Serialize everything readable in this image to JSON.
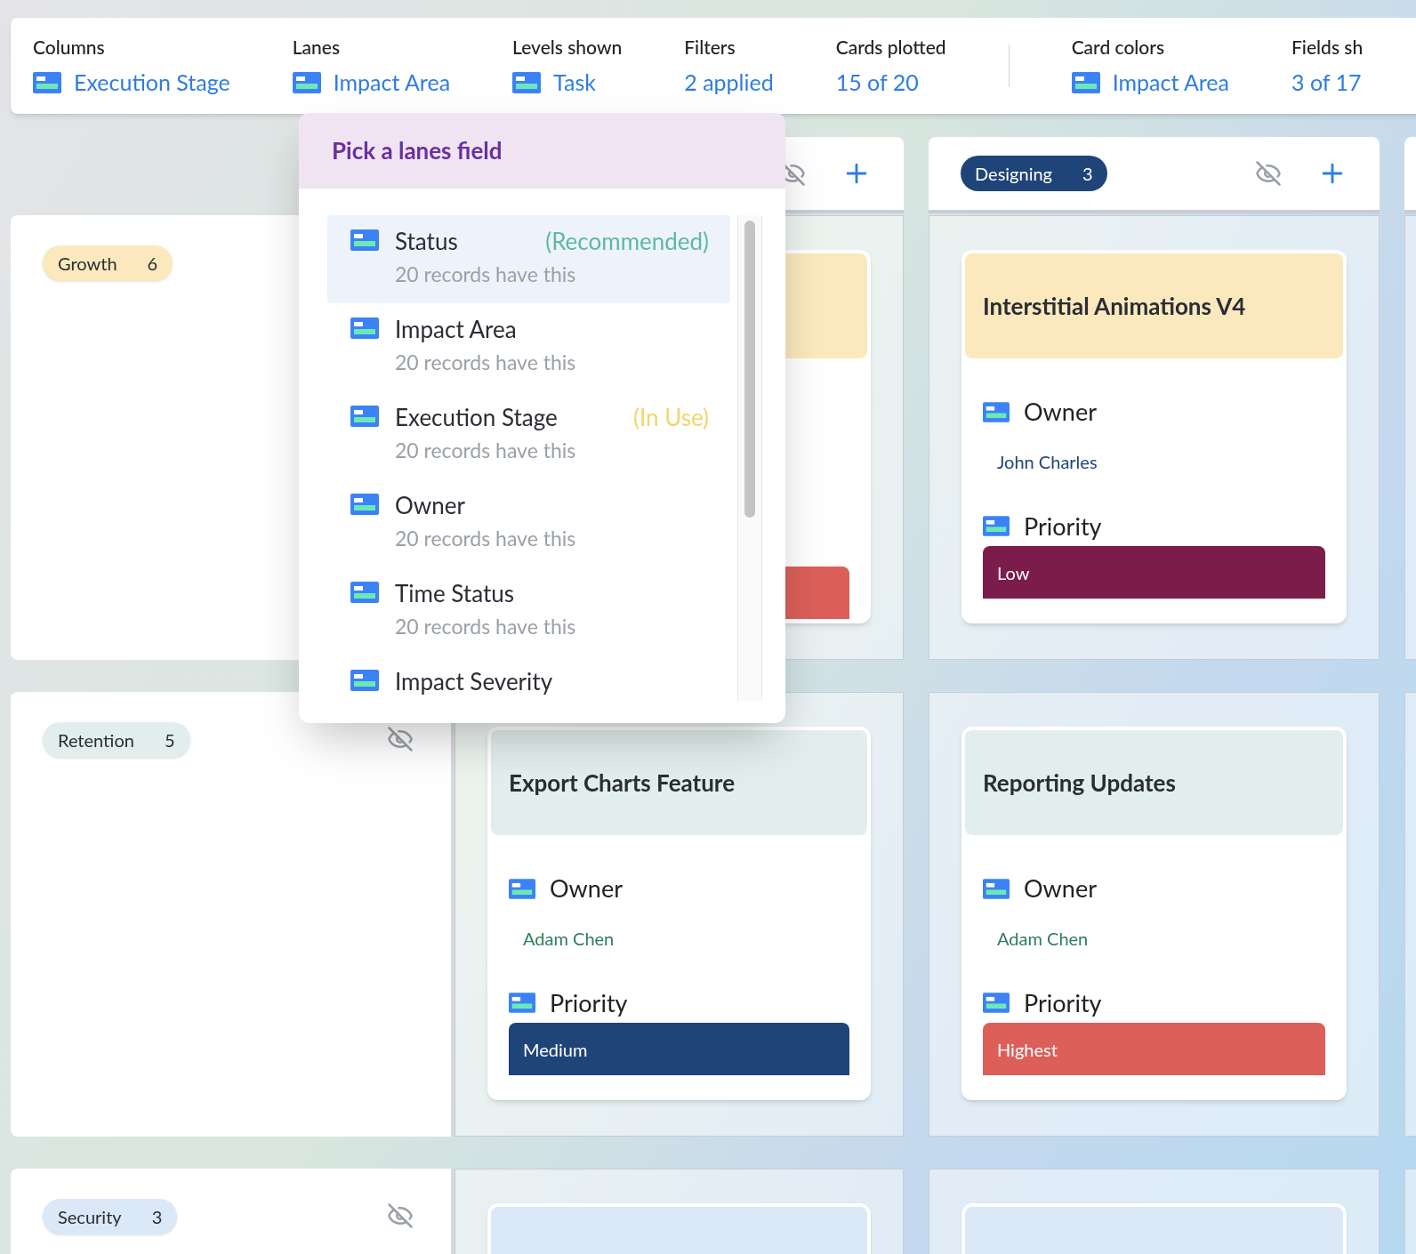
{
  "toolbar": {
    "groups": [
      [
        {
          "kind": "field",
          "label": "Columns",
          "value": "Execution Stage"
        },
        {
          "kind": "field",
          "label": "Lanes",
          "value": "Impact Area"
        },
        {
          "kind": "field",
          "label": "Levels shown",
          "value": "Task"
        },
        {
          "kind": "count",
          "label": "Filters",
          "value": "2 applied"
        },
        {
          "kind": "count",
          "label": "Cards plotted",
          "value": "15 of 20"
        }
      ],
      [
        {
          "kind": "field",
          "label": "Card colors",
          "value": "Impact Area"
        },
        {
          "kind": "count",
          "label": "Fields sh",
          "value": "3 of 17"
        }
      ]
    ]
  },
  "columns": [
    {
      "kind": "covered"
    },
    {
      "kind": "stage",
      "label": "Designing",
      "count": "3"
    },
    {
      "kind": "edge"
    }
  ],
  "lanes": [
    {
      "label": "Growth",
      "count": "6",
      "color": "#fbe9bd",
      "cards": [
        {
          "kind": "covered",
          "priority": {
            "color": "#dc5f5a"
          }
        },
        {
          "kind": "full",
          "title": "Interstitial Animations V4",
          "owner_label": "Owner",
          "owner": {
            "value": "John Charles",
            "color": "#1f4478"
          },
          "priority_label": "Priority",
          "priority": {
            "value": "Low",
            "color": "#7b1c4a"
          }
        }
      ]
    },
    {
      "label": "Retention",
      "count": "5",
      "color": "#e2eeed",
      "cards": [
        {
          "kind": "full",
          "title": "Export Charts Feature",
          "owner_label": "Owner",
          "owner": {
            "value": "Adam Chen",
            "color": "#2e7d5b"
          },
          "priority_label": "Priority",
          "priority": {
            "value": "Medium",
            "color": "#1f4478"
          }
        },
        {
          "kind": "full",
          "title": "Reporting Updates",
          "owner_label": "Owner",
          "owner": {
            "value": "Adam Chen",
            "color": "#2e7d5b"
          },
          "priority_label": "Priority",
          "priority": {
            "value": "Highest",
            "color": "#dc5f5a"
          }
        }
      ]
    },
    {
      "label": "Security",
      "count": "3",
      "color": "#dbe8f8",
      "cards": [
        {
          "kind": "cut"
        },
        {
          "kind": "cut"
        }
      ]
    }
  ],
  "lanes_menu": {
    "title": "Pick a lanes field",
    "items": [
      {
        "label": "Status",
        "note": "(Recommended)",
        "kind": "recommended",
        "sub": "20 records have this",
        "selected": true
      },
      {
        "label": "Impact Area",
        "sub": "20 records have this",
        "selected": false
      },
      {
        "label": "Execution Stage",
        "note": "(In Use)",
        "kind": "in_use",
        "sub": "20 records have this",
        "selected": false
      },
      {
        "label": "Owner",
        "sub": "20 records have this",
        "selected": false
      },
      {
        "label": "Time Status",
        "sub": "20 records have this",
        "selected": false
      },
      {
        "label": "Impact Severity",
        "selected": false
      }
    ]
  }
}
